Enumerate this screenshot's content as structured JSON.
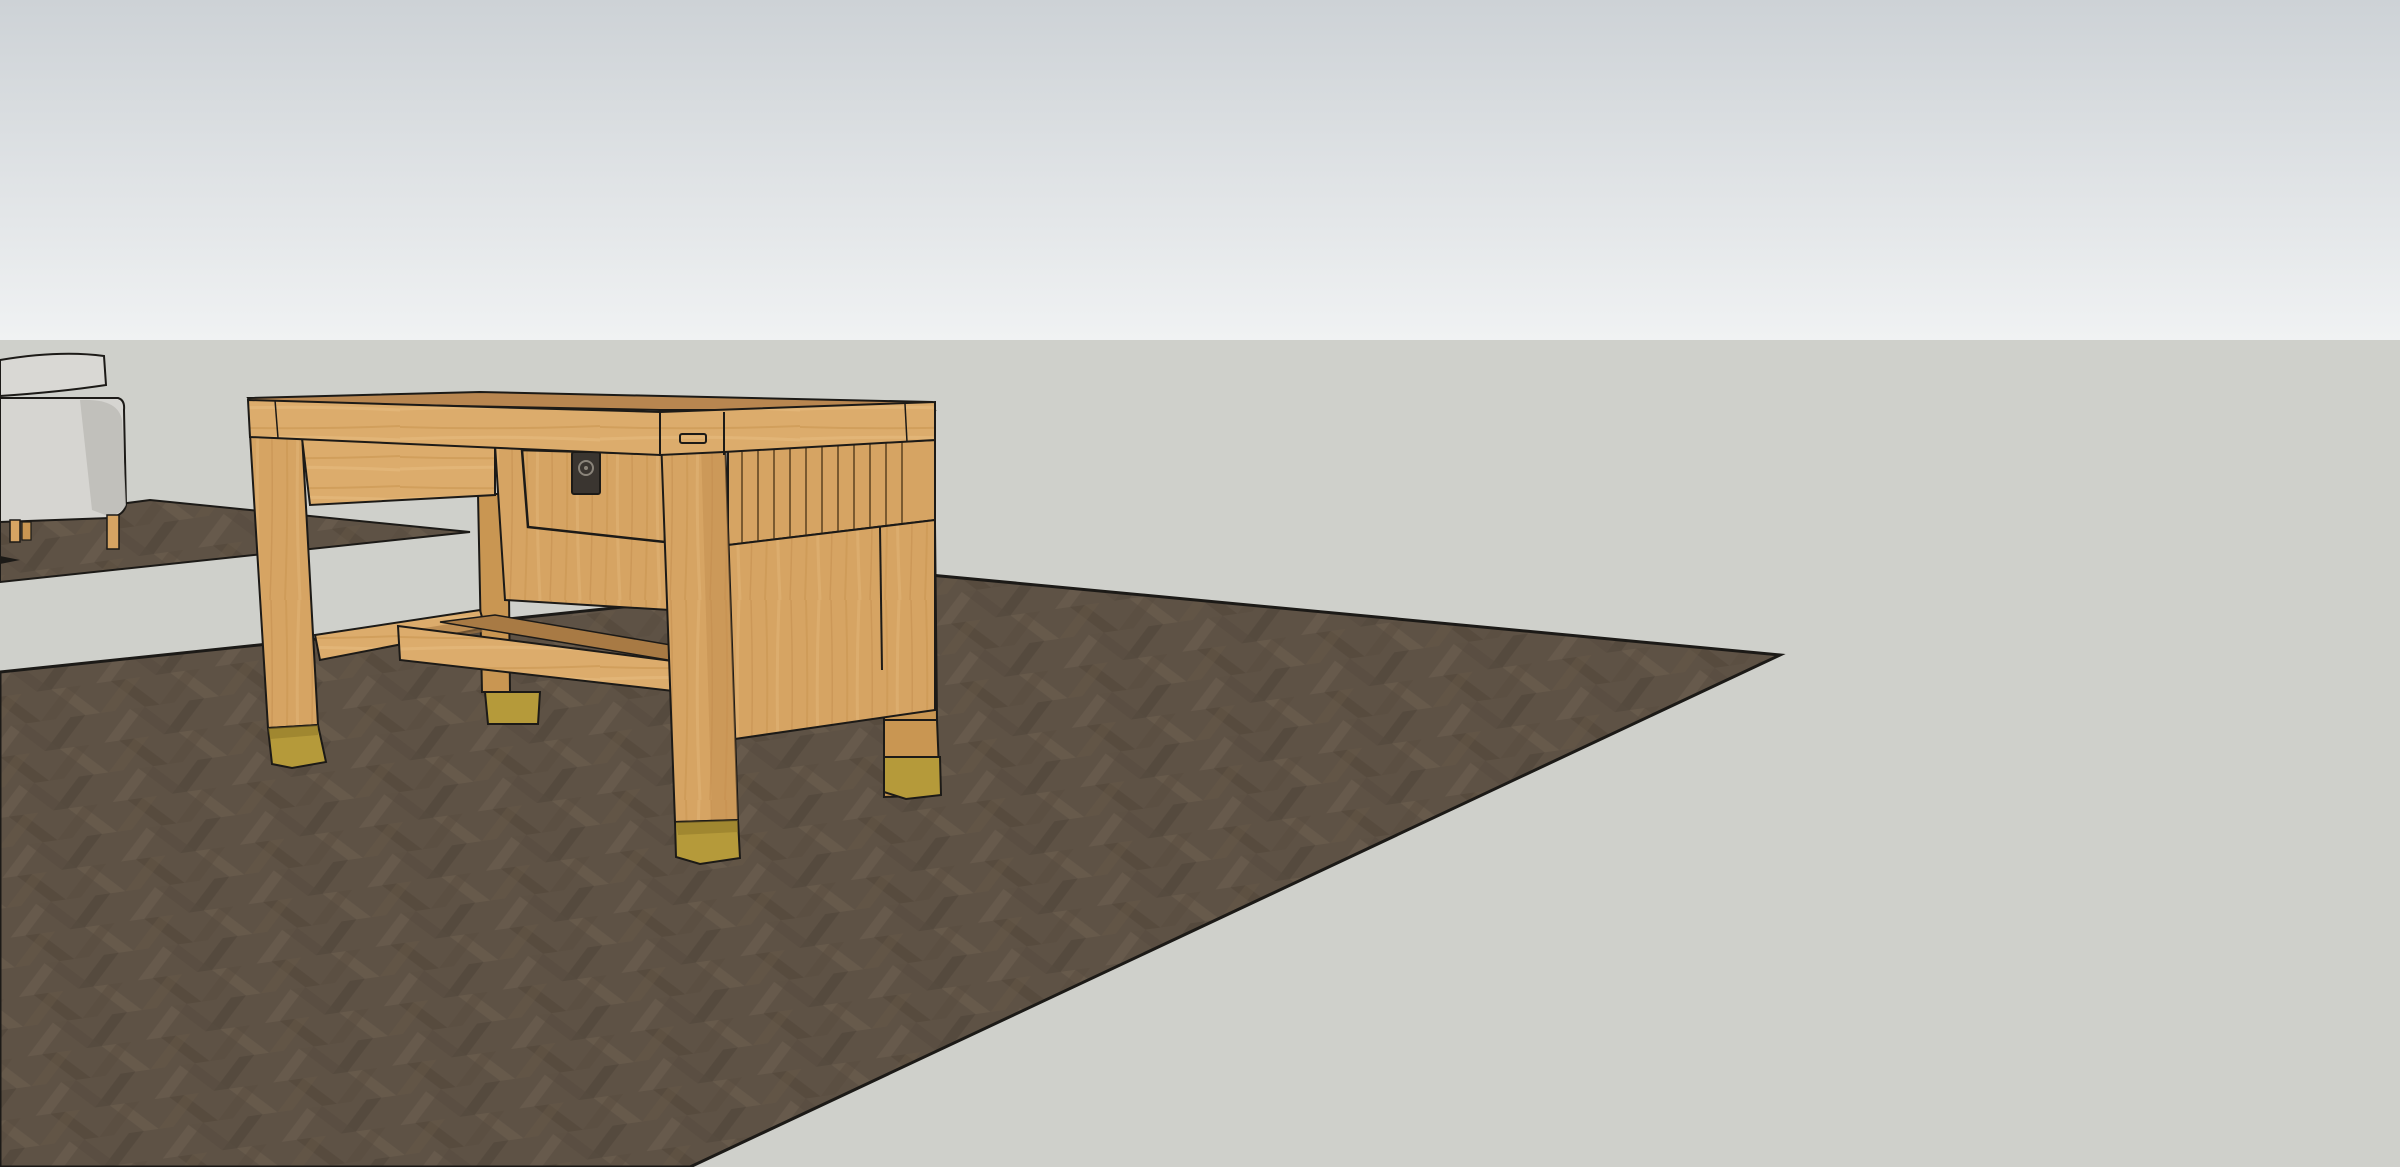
{
  "scene": {
    "type": "3d-modeling-viewport",
    "objects": [
      "sky",
      "ground-plane",
      "herringbone-rug",
      "rear-rug",
      "armchair",
      "desk"
    ]
  },
  "colors": {
    "sky_top": "#cdd2d6",
    "sky_bottom": "#f0f2f3",
    "ground": "#cfd0cb",
    "rug": "#5e5245",
    "rug_dark": "#4f4438",
    "rug_light": "#6f6152",
    "wood": "#d6a463",
    "wood_light": "#e2b577",
    "wood_dark": "#c08c4e",
    "wood_shadow": "#a87a44",
    "brass": "#b59a3a",
    "brass_dark": "#8c7326",
    "fabric": "#d9d8d4",
    "fabric_shadow": "#bdbcb7",
    "edge": "#1c1a17"
  }
}
